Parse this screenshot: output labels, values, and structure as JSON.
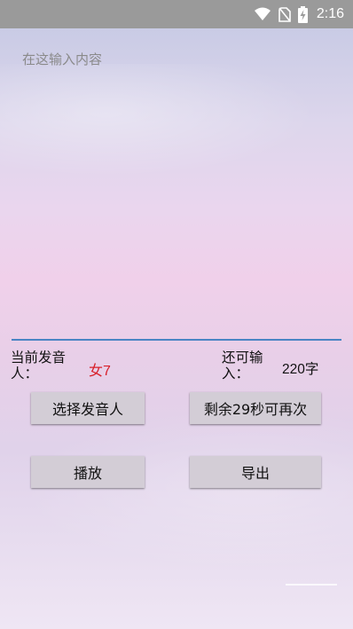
{
  "status_bar": {
    "time": "2:16",
    "icons": [
      "wifi-icon",
      "no-sim-icon",
      "battery-charging-icon"
    ]
  },
  "text_input": {
    "placeholder": "在这输入内容",
    "value": ""
  },
  "speaker": {
    "label_line1": "当前发音",
    "label_line2": "人：",
    "value": "女7",
    "value_color": "#d8202a"
  },
  "remaining": {
    "label_line1": "还可输",
    "label_line2": "入：",
    "value": "220字"
  },
  "buttons": {
    "choose_speaker": "选择发音人",
    "cooldown": "剩余29秒可再次",
    "play": "播放",
    "export": "导出"
  },
  "colors": {
    "accent_underline": "#4a85c4",
    "status_bar": "#9a9a9a",
    "button_bg": "#d3cdd6"
  }
}
